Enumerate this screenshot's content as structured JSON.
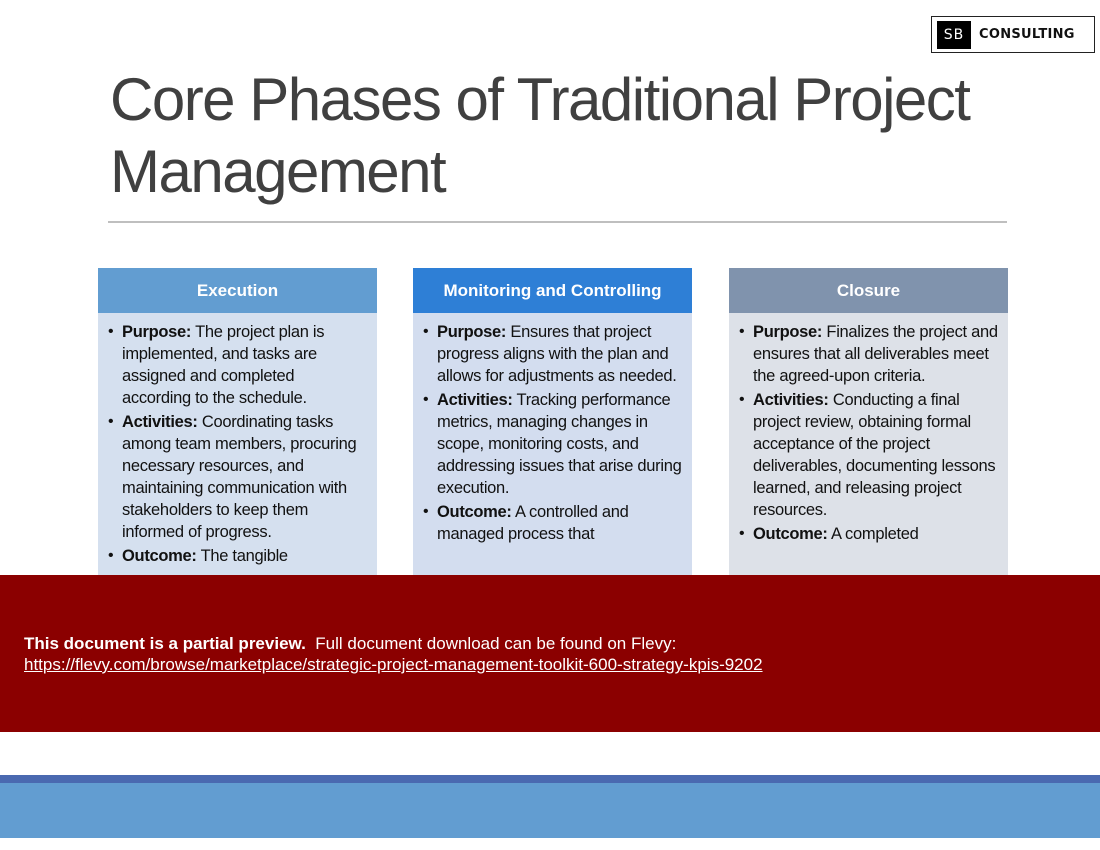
{
  "logo": {
    "mark": "SB",
    "text": "CONSULTING"
  },
  "title": "Core Phases of Traditional Project Management",
  "colors": {
    "execution_header": "#629dd1",
    "execution_body": "#d5e0ef",
    "monitoring_header": "#2e7fd6",
    "monitoring_body": "#d3ddef",
    "closure_header": "#8093ad",
    "closure_body": "#dde1e8",
    "banner": "#8b0000"
  },
  "columns": [
    {
      "header": "Execution",
      "items": [
        {
          "label": "Purpose:",
          "text": " The project plan is implemented, and tasks are assigned and completed according to the schedule."
        },
        {
          "label": "Activities:",
          "text": " Coordinating tasks among team members, procuring necessary resources, and maintaining communication with stakeholders to keep them informed of progress."
        },
        {
          "label": "Outcome:",
          "text": " The tangible"
        }
      ]
    },
    {
      "header": "Monitoring and Controlling",
      "items": [
        {
          "label": "Purpose:",
          "text": " Ensures that project progress aligns with the plan and allows for adjustments as needed."
        },
        {
          "label": "Activities:",
          "text": " Tracking performance metrics, managing changes in scope, monitoring costs, and addressing issues that arise during execution."
        },
        {
          "label": "Outcome:",
          "text": " A controlled and managed process that"
        }
      ]
    },
    {
      "header": "Closure",
      "items": [
        {
          "label": "Purpose:",
          "text": " Finalizes the project and ensures that all deliverables meet the agreed-upon criteria."
        },
        {
          "label": "Activities:",
          "text": " Conducting a final project review, obtaining formal acceptance of the project deliverables, documenting lessons learned, and releasing project resources."
        },
        {
          "label": "Outcome:",
          "text": " A completed"
        }
      ]
    }
  ],
  "banner": {
    "bold": "This document is a partial preview.",
    "text": "  Full document download can be found on Flevy:",
    "link": "https://flevy.com/browse/marketplace/strategic-project-management-toolkit-600-strategy-kpis-9202"
  }
}
